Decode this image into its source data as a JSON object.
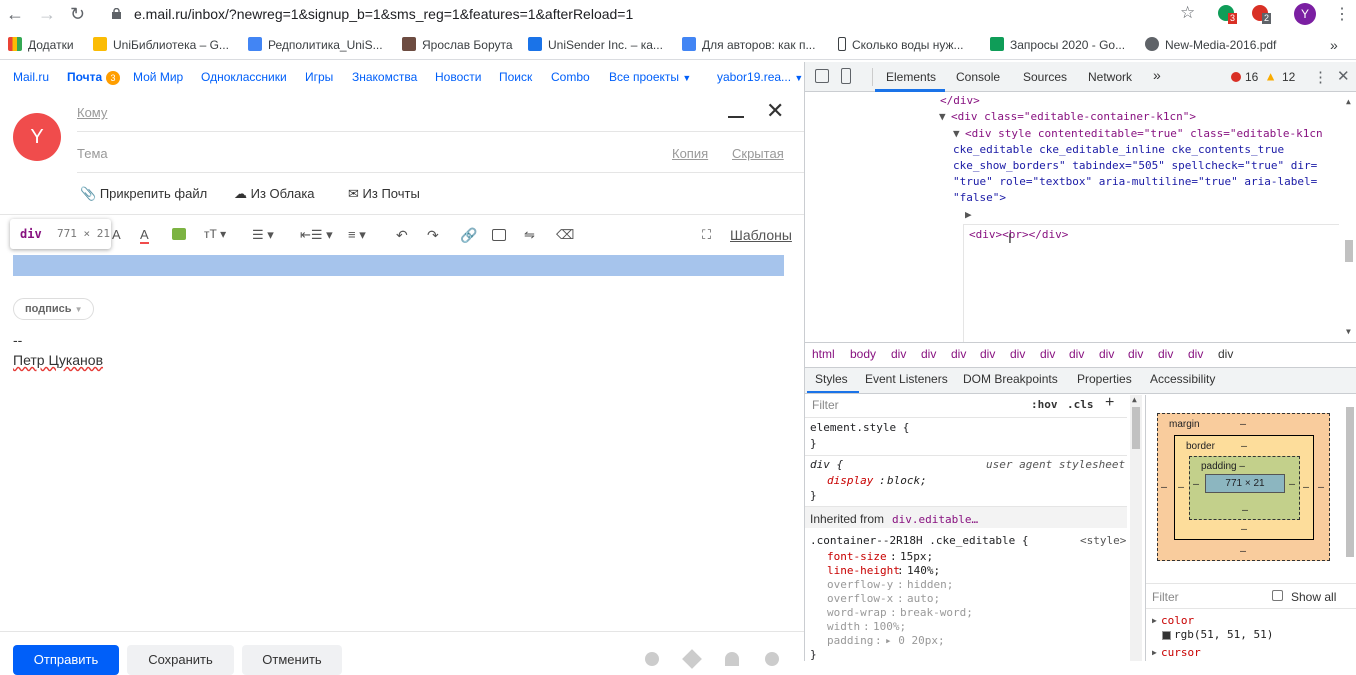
{
  "browser": {
    "url": "e.mail.ru/inbox/?newreg=1&signup_b=1&sms_reg=1&features=1&afterReload=1",
    "avatar_letter": "Y",
    "ext_badge_1": "3",
    "ext_badge_2": "2"
  },
  "bookmarks": [
    {
      "label": "Додатки",
      "color": "#ea4335"
    },
    {
      "label": "UniБиблиотека – G...",
      "color": "#fbbc04"
    },
    {
      "label": "Редполитика_UniS...",
      "color": "#4285f4"
    },
    {
      "label": "Ярослав Борута",
      "color": "#6d4c41"
    },
    {
      "label": "UniSender Inc. – ка...",
      "color": "#1a73e8"
    },
    {
      "label": "Для авторов: как п...",
      "color": "#4285f4"
    },
    {
      "label": "Сколько воды нуж...",
      "color": "#3c4043"
    },
    {
      "label": "Запросы 2020 - Go...",
      "color": "#0f9d58"
    },
    {
      "label": "New-Media-2016.pdf",
      "color": "#5f6368"
    }
  ],
  "mailnav": {
    "items": [
      "Mail.ru",
      "Почта",
      "Мой Мир",
      "Одноклассники",
      "Игры",
      "Знакомства",
      "Новости",
      "Поиск",
      "Combo",
      "Все проекты"
    ],
    "mail_count": "3",
    "user": "yabor19.rea..."
  },
  "compose": {
    "avatar_letter": "Y",
    "to_label": "Кому",
    "subject_label": "Тема",
    "copy_label": "Копия",
    "hidden_label": "Скрытая",
    "attach_file": "Прикрепить файл",
    "from_cloud": "Из Облака",
    "from_mail": "Из Почты",
    "templates": "Шаблоны",
    "tooltip_tag": "div",
    "tooltip_size": "771 × 21",
    "signature_btn": "подпись",
    "sig_dashes": "--",
    "sig_name": "Петр Цуканов",
    "send": "Отправить",
    "save": "Сохранить",
    "cancel": "Отменить"
  },
  "devtools": {
    "tabs": [
      "Elements",
      "Console",
      "Sources",
      "Network"
    ],
    "errors": "16",
    "warnings": "12",
    "code_lines": [
      "</div>",
      "<div class=\"editable-container-k1cn\">",
      "<div style contenteditable=\"true\" class=\"editable-k1cn",
      "cke_editable cke_editable_inline cke_contents_true",
      "cke_show_borders\" tabindex=\"505\" spellcheck=\"true\" dir=",
      "\"true\" role=\"textbox\" aria-multiline=\"true\" aria-label=",
      "\"false\">",
      "<div><br></div>"
    ],
    "breadcrumbs": [
      "html",
      "body",
      "div",
      "div",
      "div",
      "div",
      "div",
      "div",
      "div",
      "div",
      "div",
      "div",
      "div",
      "div"
    ],
    "subtabs": [
      "Styles",
      "Event Listeners",
      "DOM Breakpoints",
      "Properties",
      "Accessibility"
    ],
    "filter_placeholder": "Filter",
    "hov": ":hov",
    "cls": ".cls",
    "element_style": "element.style {",
    "close_brace": "}",
    "div_rule": "div {",
    "ua_stylesheet": "user agent stylesheet",
    "display_prop": "display",
    "display_val": "block;",
    "inherited_label": "Inherited from",
    "inherited_sel": "div.editable…",
    "container_sel": ".container--2R18H .cke_editable {",
    "style_src": "<style>",
    "props": [
      {
        "p": "font-size",
        "v": "15px;"
      },
      {
        "p": "line-height",
        "v": "140%;"
      },
      {
        "p": "overflow-y",
        "v": "hidden;"
      },
      {
        "p": "overflow-x",
        "v": "auto;"
      },
      {
        "p": "word-wrap",
        "v": "break-word;"
      },
      {
        "p": "width",
        "v": "100%;"
      },
      {
        "p": "padding",
        "v": "▸ 0 20px;"
      }
    ],
    "box": {
      "margin": "margin",
      "border": "border",
      "padding": "padding",
      "content": "771 × 21",
      "dash": "–"
    },
    "computed_filter": "Filter",
    "show_all": "Show all",
    "computed": [
      {
        "p": "color",
        "v": "rgb(51, 51, 51)"
      },
      {
        "p": "cursor",
        "v": ""
      }
    ]
  }
}
